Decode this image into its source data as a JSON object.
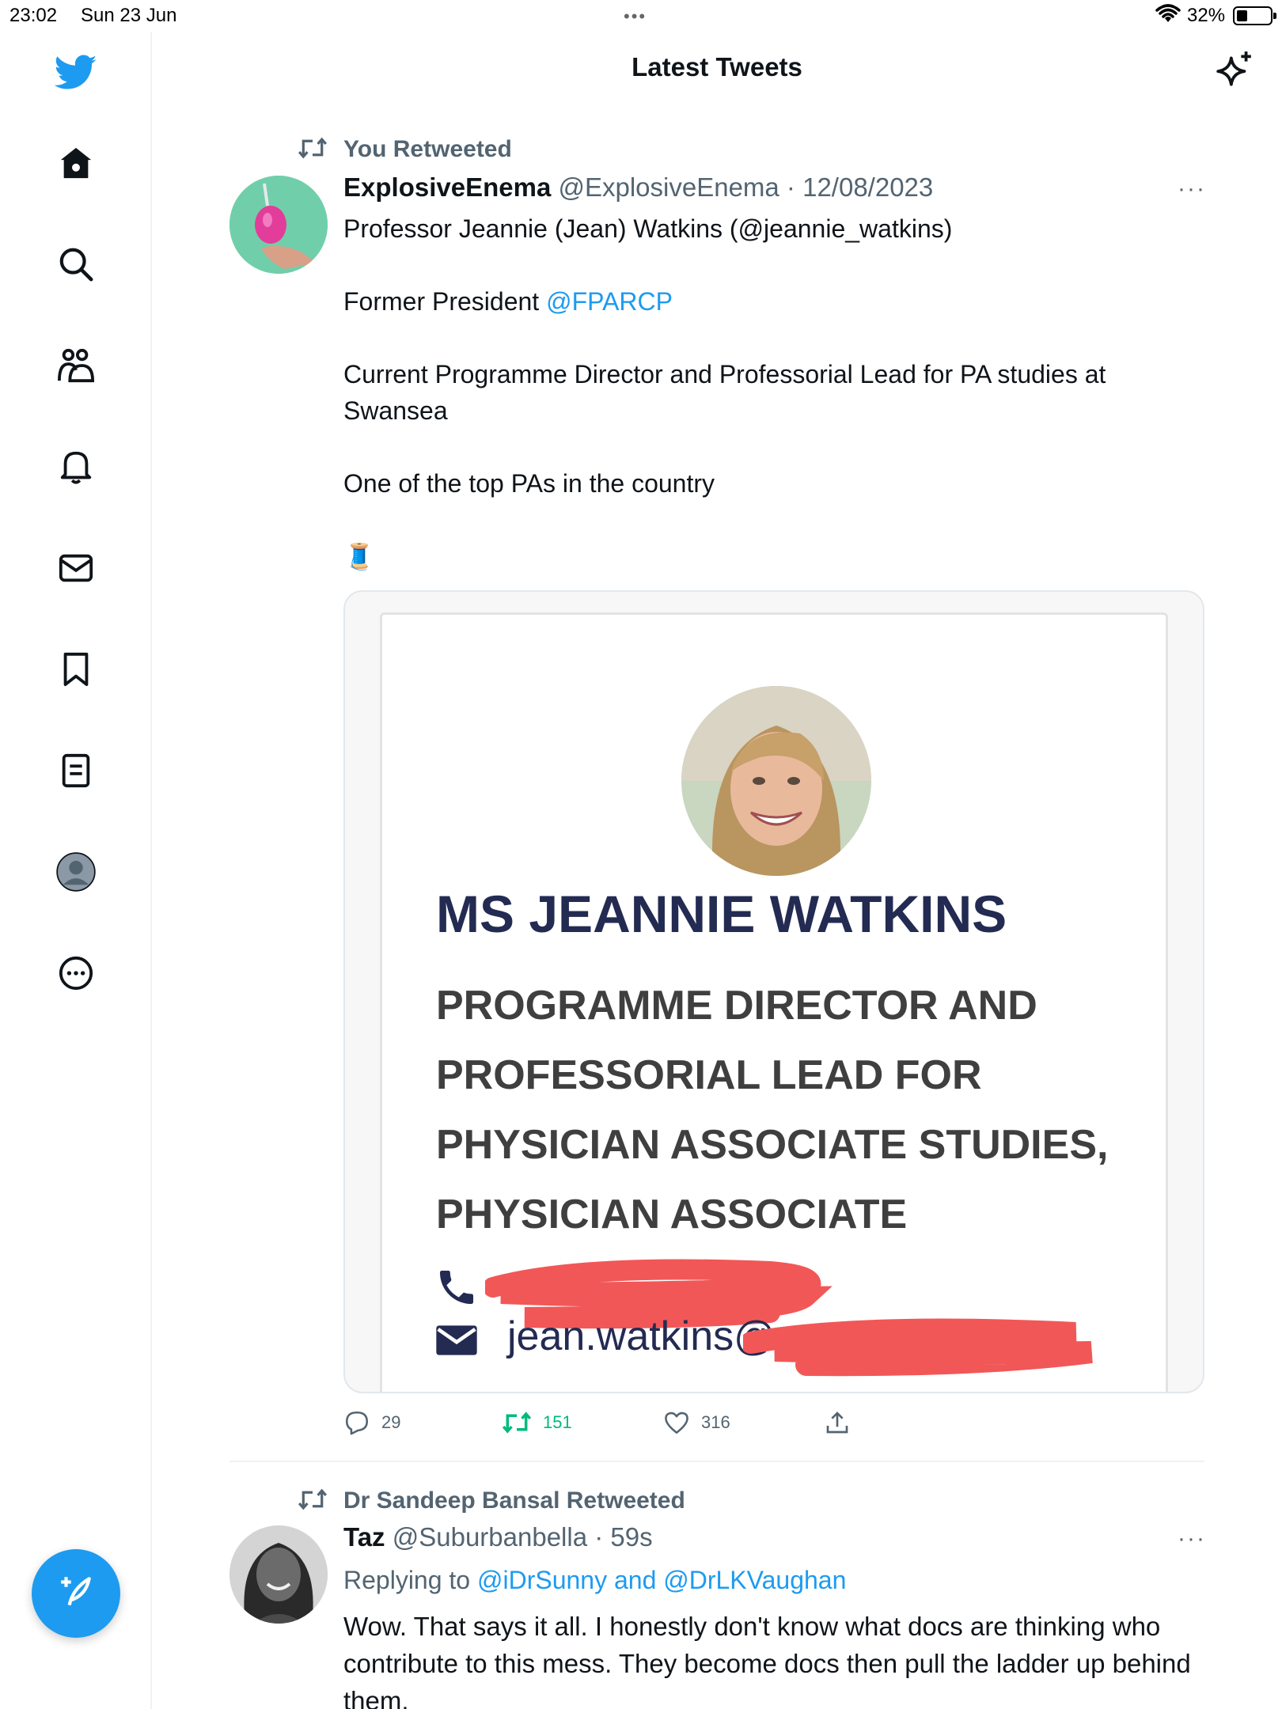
{
  "status_bar": {
    "time": "23:02",
    "date": "Sun 23 Jun",
    "dots": "•••",
    "battery": "32%",
    "battery_level": 0.32
  },
  "header": {
    "title": "Latest Tweets",
    "sparkle_icon": "sparkle-icon"
  },
  "sidebar": {
    "items": [
      {
        "name": "twitter-logo-icon"
      },
      {
        "name": "home-icon"
      },
      {
        "name": "search-icon"
      },
      {
        "name": "communities-icon"
      },
      {
        "name": "notifications-bell-icon"
      },
      {
        "name": "messages-envelope-icon"
      },
      {
        "name": "bookmark-icon"
      },
      {
        "name": "lists-icon"
      },
      {
        "name": "profile-avatar-icon"
      },
      {
        "name": "more-circle-icon"
      }
    ],
    "compose_icon": "compose-feather-plus-icon"
  },
  "tweet1": {
    "context": "You Retweeted",
    "name": "ExplosiveEnema",
    "meta": "@ExplosiveEnema · 12/08/2023",
    "more": "···",
    "line1": "Professor Jeannie (Jean) Watkins (@jeannie_watkins)",
    "line2_prefix": "Former President ",
    "line2_link": "@FPARCP",
    "line3": "Current Programme Director and Professorial Lead for PA studies at Swansea",
    "line4": "One of the top PAs in the country",
    "emoji": "🧵",
    "card": {
      "name": "MS JEANNIE WATKINS",
      "title": "PROGRAMME DIRECTOR AND PROFESSORIAL LEAD FOR PHYSICIAN ASSOCIATE STUDIES, PHYSICIAN ASSOCIATE",
      "email_visible": "jean.watkins@"
    },
    "replies": "29",
    "retweets": "151",
    "likes": "316",
    "colors": {
      "link": "#1d9bf0",
      "retweet_active": "#00ba7c",
      "redaction": "#f25757"
    }
  },
  "tweet2": {
    "context": "Dr Sandeep Bansal Retweeted",
    "name": "Taz",
    "meta": "@Suburbanbella · 59s",
    "more": "···",
    "reply_prefix": "Replying to ",
    "reply_to": "@iDrSunny and @DrLKVaughan",
    "text": "Wow. That says it all. I honestly don't know what docs are thinking who contribute to this mess. They become docs then pull the ladder up behind them."
  }
}
